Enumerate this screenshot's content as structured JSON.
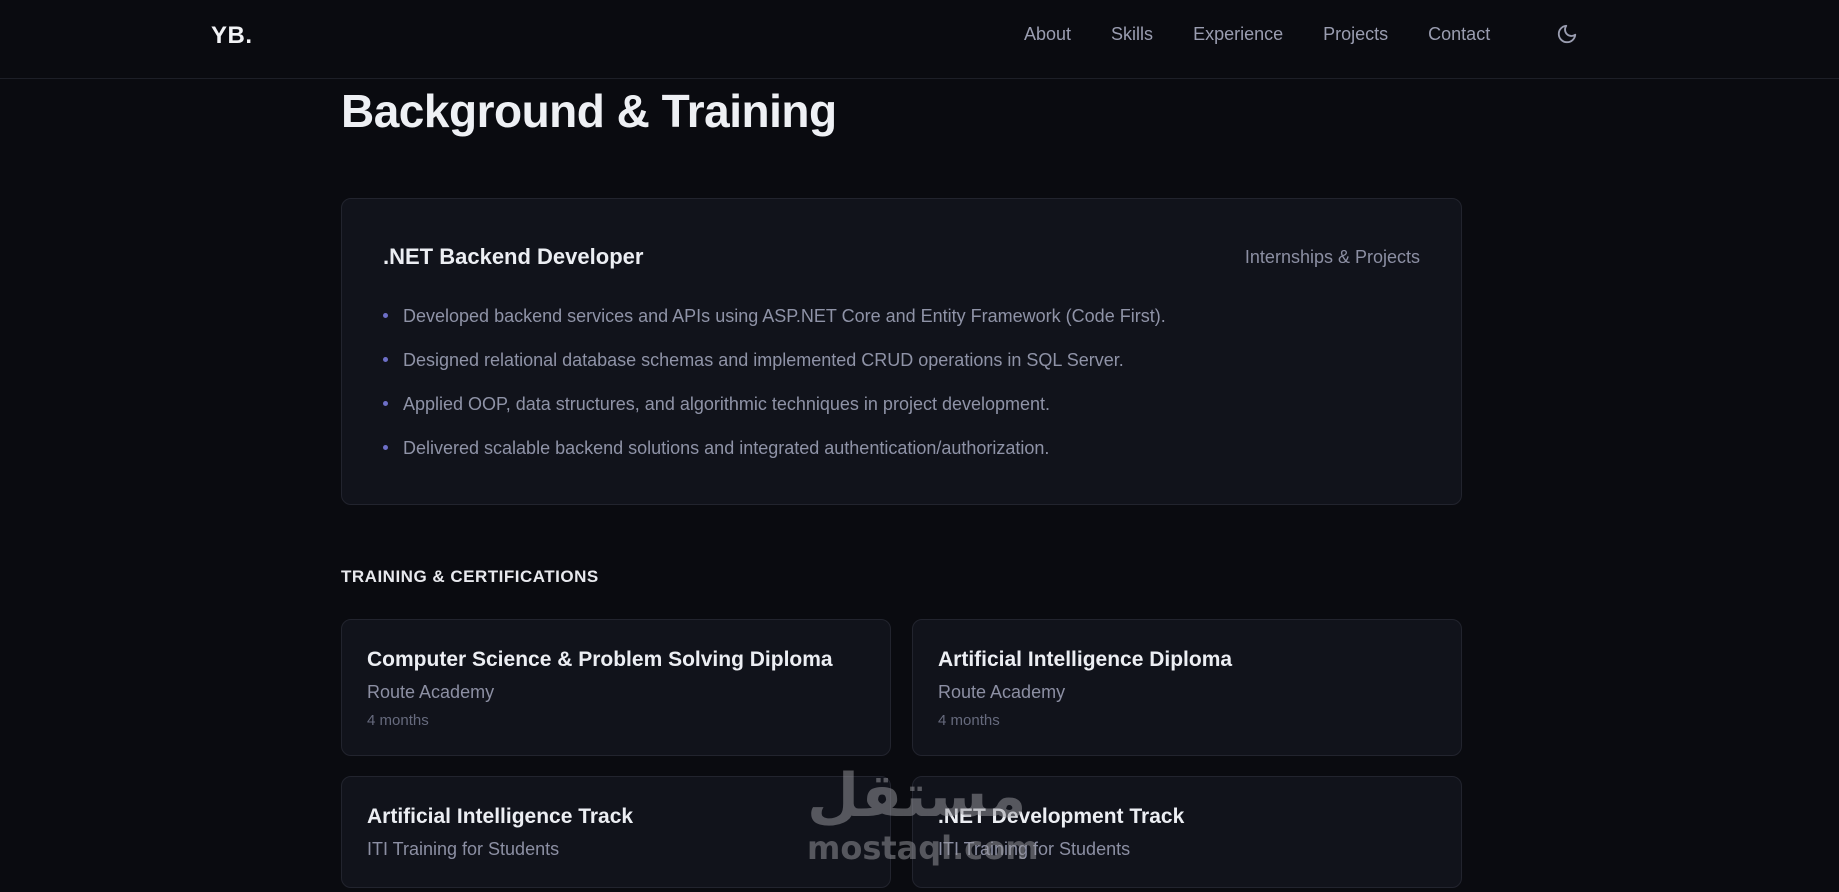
{
  "nav": {
    "logo": "YB.",
    "links": [
      "About",
      "Skills",
      "Experience",
      "Projects",
      "Contact"
    ],
    "theme_toggle_icon": "moon-icon"
  },
  "section": {
    "title": "Background & Training"
  },
  "experience": {
    "title": ".NET Backend Developer",
    "meta": "Internships & Projects",
    "bullets": [
      "Developed backend services and APIs using ASP.NET Core and Entity Framework (Code First).",
      "Designed relational database schemas and implemented CRUD operations in SQL Server.",
      "Applied OOP, data structures, and algorithmic techniques in project development.",
      "Delivered scalable backend solutions and integrated authentication/authorization."
    ]
  },
  "training": {
    "heading": "TRAINING & CERTIFICATIONS",
    "cards": [
      {
        "title": "Computer Science & Problem Solving Diploma",
        "org": "Route Academy",
        "duration": "4 months"
      },
      {
        "title": "Artificial Intelligence Diploma",
        "org": "Route Academy",
        "duration": "4 months"
      },
      {
        "title": "Artificial Intelligence Track",
        "org": "ITI Training for Students"
      },
      {
        "title": ".NET Development Track",
        "org": "ITI Training for Students"
      }
    ]
  },
  "watermark": {
    "arabic": "مستقل",
    "latin": "mostaql.com"
  },
  "colors": {
    "background": "#0a0b10",
    "card": "#11131b",
    "bullet_accent": "#6d6fc7"
  }
}
